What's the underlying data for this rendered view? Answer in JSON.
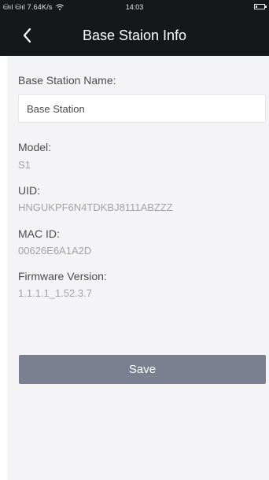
{
  "status_bar": {
    "signal": "⛁ıl ⛁ıl 7.64K/s",
    "time": "14:03"
  },
  "header": {
    "title": "Base Staion Info"
  },
  "form": {
    "name_label": "Base Station Name:",
    "name_value": "Base Station",
    "model_label": "Model:",
    "model_value": "S1",
    "uid_label": "UID:",
    "uid_value": "HNGUKPF6N4TDKBJ8111ABZZZ",
    "mac_label": "MAC ID:",
    "mac_value": "00626E6A1A2D",
    "firmware_label": "Firmware Version:",
    "firmware_value": "1.1.1.1_1.52.3.7",
    "save_label": "Save"
  },
  "icons": {
    "back": "chevron-left-icon",
    "wifi": "wifi-icon",
    "battery": "battery-icon"
  },
  "colors": {
    "header_bg": "#16171b",
    "content_bg": "#f4f4f6",
    "save_button_bg": "#7a808f"
  },
  "battery_level": 0.2
}
